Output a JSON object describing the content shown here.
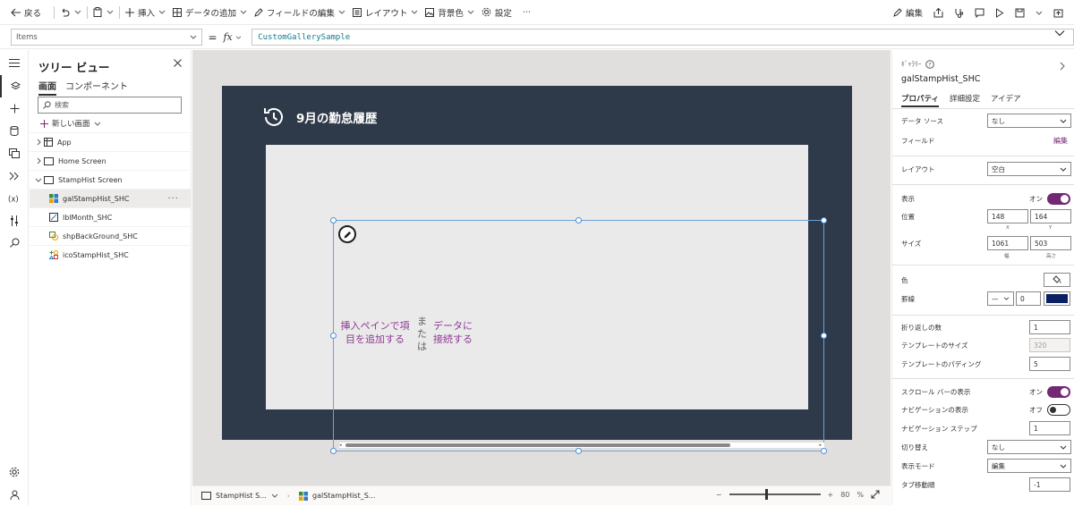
{
  "toolbar": {
    "back": "戻る",
    "insert": "挿入",
    "add_data": "データの追加",
    "edit_fields": "フィールドの編集",
    "layout": "レイアウト",
    "background": "背景色",
    "settings": "設定",
    "more": "⋯",
    "edit_right": "編集"
  },
  "formula": {
    "property": "Items",
    "equals": "=",
    "fx": "fx",
    "value": "CustomGallerySample"
  },
  "tree": {
    "title": "ツリー ビュー",
    "tab_screens": "画面",
    "tab_components": "コンポーネント",
    "search_placeholder": "検索",
    "new_screen": "新しい画面",
    "nodes": [
      {
        "label": "App"
      },
      {
        "label": "Home Screen"
      },
      {
        "label": "StampHist Screen"
      },
      {
        "label": "galStampHist_SHC"
      },
      {
        "label": "lblMonth_SHC"
      },
      {
        "label": "shpBackGround_SHC"
      },
      {
        "label": "icoStampHist_SHC"
      }
    ]
  },
  "canvas": {
    "screen_title": "9月の勤怠履歴",
    "placeholder_left": "挿入ペインで項目を追加する",
    "placeholder_mid": "または",
    "placeholder_right": "データに接続する"
  },
  "status": {
    "screen_crumb": "StampHist S...",
    "control_crumb": "galStampHist_S...",
    "zoom_minus": "−",
    "zoom_plus": "+",
    "zoom_value": "80",
    "zoom_unit": "%",
    "zoom_level": 0.4
  },
  "props": {
    "control_type": "ｷﾞｬﾗﾘｰ",
    "control_name": "galStampHist_SHC",
    "tab_properties": "プロパティ",
    "tab_advanced": "詳細設定",
    "tab_ideas": "アイデア",
    "datasource_label": "データ ソース",
    "datasource_value": "なし",
    "fields_label": "フィールド",
    "fields_edit": "編集",
    "layout_label": "レイアウト",
    "layout_value": "空白",
    "visible_label": "表示",
    "visible_value": "オン",
    "position_label": "位置",
    "pos_x": "148",
    "pos_y": "164",
    "pos_x_label": "X",
    "pos_y_label": "Y",
    "size_label": "サイズ",
    "width": "1061",
    "height": "503",
    "width_label": "幅",
    "height_label": "高さ",
    "color_label": "色",
    "border_label": "罫線",
    "border_width": "0",
    "border_color": "#0b1f63",
    "wrap_label": "折り返しの数",
    "wrap_value": "1",
    "template_size_label": "テンプレートのサイズ",
    "template_size_value": "320",
    "template_padding_label": "テンプレートのパディング",
    "template_padding_value": "5",
    "scrollbar_label": "スクロール バーの表示",
    "scrollbar_value": "オン",
    "navigation_label": "ナビゲーションの表示",
    "navigation_value": "オフ",
    "nav_step_label": "ナビゲーション ステップ",
    "nav_step_value": "1",
    "transition_label": "切り替え",
    "transition_value": "なし",
    "display_mode_label": "表示モード",
    "display_mode_value": "編集",
    "tab_index_label": "タブ移動順",
    "tab_index_value": "-1"
  },
  "colors": {
    "screen_bg": "#2e3949",
    "accent": "#742774",
    "placeholder": "#8e3a93"
  }
}
